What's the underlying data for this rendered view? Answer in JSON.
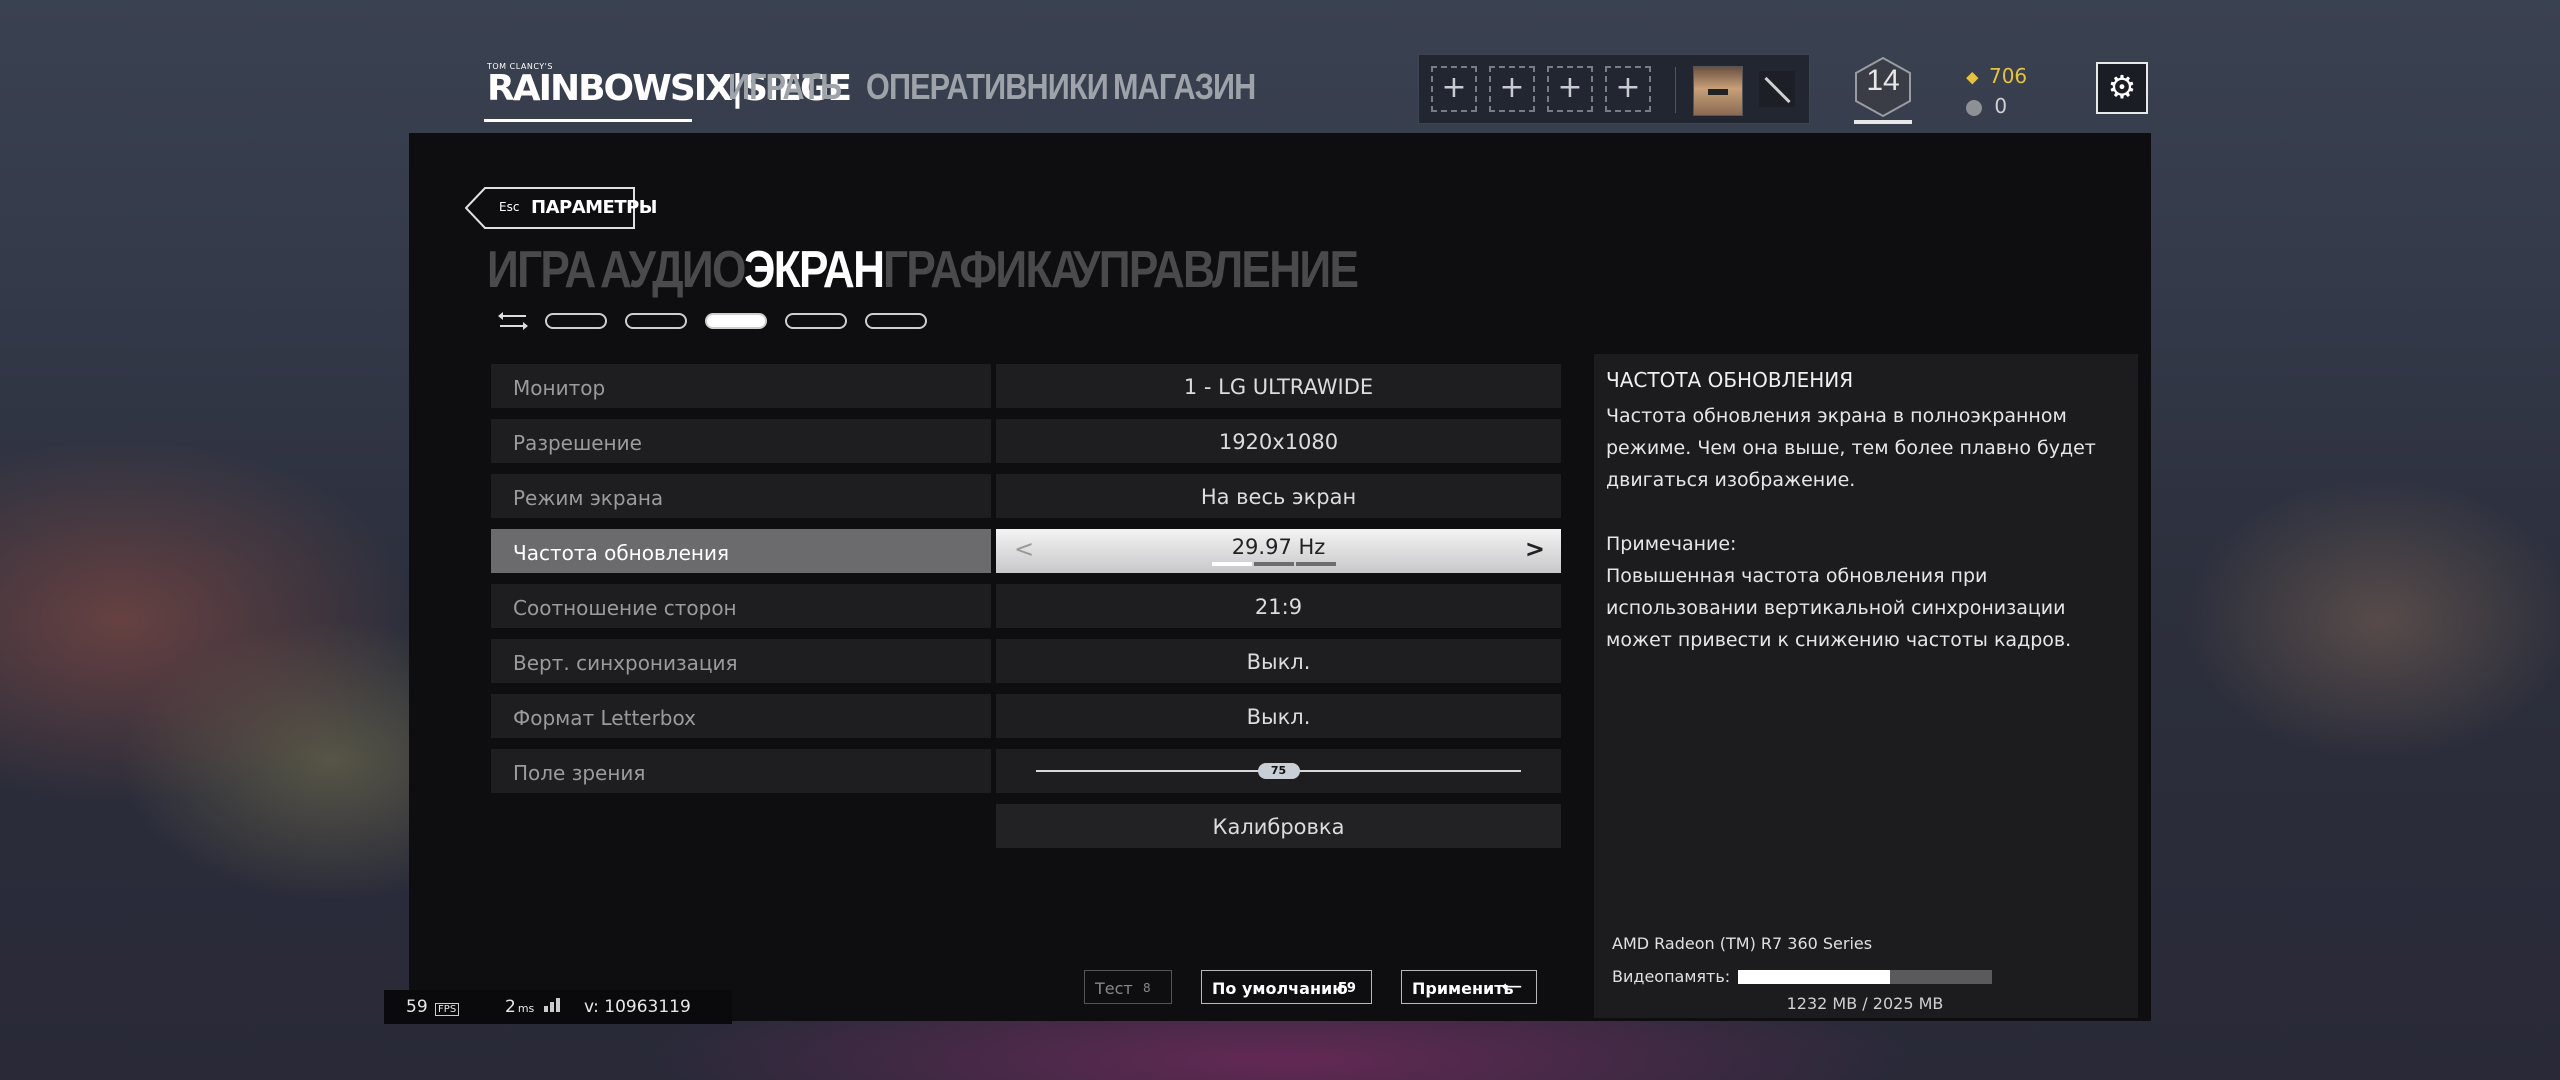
{
  "logo": {
    "small": "TOM CLANCY'S",
    "title": "RAINBOWSIX|SIEGE"
  },
  "nav": {
    "play": "ИГРАТЬ",
    "operators": "ОПЕРАТИВНИКИ",
    "shop": "МАГАЗИН"
  },
  "squad": {
    "add_slot": "+"
  },
  "player": {
    "level": "14"
  },
  "currency": {
    "renown": "706",
    "credits": "0"
  },
  "back": {
    "key": "Esc",
    "label": "ПАРАМЕТРЫ"
  },
  "tabs": [
    "ИГРА",
    "АУДИО",
    "ЭКРАН",
    "ГРАФИКА",
    "УПРАВЛЕНИЕ"
  ],
  "active_tab": "ЭКРАН",
  "subtabs_count": 5,
  "active_subtab": 3,
  "settings": [
    {
      "label": "Монитор",
      "value": "1 - LG ULTRAWIDE"
    },
    {
      "label": "Разрешение",
      "value": "1920x1080"
    },
    {
      "label": "Режим экрана",
      "value": "На весь экран"
    },
    {
      "label": "Частота обновления",
      "value": "29.97 Hz",
      "selected": true
    },
    {
      "label": "Соотношение сторон",
      "value": "21:9"
    },
    {
      "label": "Верт. синхронизация",
      "value": "Выкл."
    },
    {
      "label": "Формат Letterbox",
      "value": "Выкл."
    },
    {
      "label": "Поле зрения",
      "value": "75",
      "slider_fraction": 0.5
    },
    {
      "label": "",
      "value": "Калибровка"
    }
  ],
  "info": {
    "title": "ЧАСТОТА ОБНОВЛЕНИЯ",
    "description": "Частота обновления экрана в полноэкранном режиме. Чем она выше, тем более плавно будет двигаться изображение.",
    "note_title": "Примечание:",
    "note": "Повышенная частота обновления при использовании вертикальной синхронизации может привести к снижению частоты кадров.",
    "gpu": "AMD Radeon (TM) R7 360 Series",
    "vram_label": "Видеопамять:",
    "vram_fraction": 0.6,
    "vram_value": "1232 MB / 2025 MB"
  },
  "buttons": {
    "test": "Тест",
    "test_key": "8",
    "default": "По умолчанию",
    "default_key": "F9",
    "apply": "Применить",
    "apply_key": "⟵"
  },
  "stats": {
    "fps": "59",
    "fps_label": "FPS",
    "ping": "2",
    "ping_unit": "ms",
    "version": "v: 10963119"
  },
  "colors": {
    "accent_gold": "#e8c23a",
    "panel_bg": "#0e0e10",
    "selected_row": "#6b6b6d"
  }
}
